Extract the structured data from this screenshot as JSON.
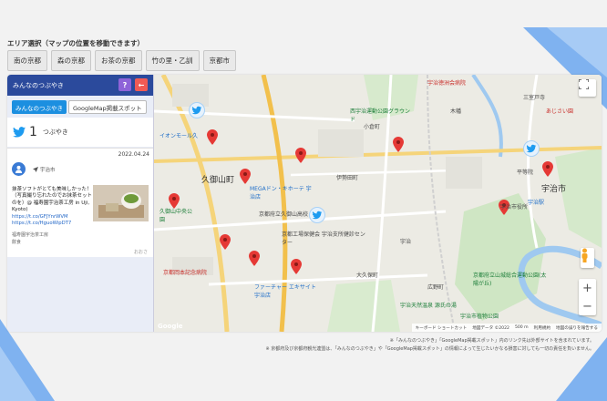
{
  "area": {
    "title": "エリア選択（マップの位置を移動できます）",
    "buttons": [
      "南の京都",
      "森の京都",
      "お茶の京都",
      "竹の里・乙訓",
      "京都市"
    ]
  },
  "panel": {
    "title": "みんなのつぶやき",
    "help_label": "?",
    "back_label": "←",
    "tabs": [
      "みんなのつぶやき",
      "GoogleMap掲載スポット"
    ],
    "count": "1",
    "count_unit": "つぶやき"
  },
  "post": {
    "date": "2022.04.24",
    "location": "宇治市",
    "text": "抹茶ソフトがとても美味しかった！（写真撮り忘れたのでお抹茶セットのを）@ 福寿園宇治茶工房 in Uji, Kyoto)",
    "links": [
      "https://t.co/GFJYnrWVM",
      "https://t.co/HguoWipDT7"
    ],
    "meta": [
      "福寿園宇治茶工房",
      "飲食"
    ],
    "footer": "おおさ"
  },
  "map": {
    "labels": {
      "okubo": "久御山町",
      "ujishi": "宇治市",
      "ion": "イオンモール久",
      "mega": "MEGAドン・キホーテ 宇治店",
      "uji_hospital": "宇治徳洲会病院",
      "higashi": "宇治市役所",
      "jinja": "宇治天然温泉 源氏の湯",
      "ujinabe": "大久保町",
      "fast": "ファーチャー エキサイト 宇治店",
      "kyoto_okamoto": "京都岡本記念病院",
      "uji_botanic": "宇治市植物公園",
      "higashi_shrine": "京都府立山城総合運動公園(太陽が丘)",
      "koyama": "小倉町",
      "kubo": "久御山中央公園",
      "nishiogura": "西宇治運動公園グラウンド",
      "ujistation": "宇治駅",
      "kobata": "木幡",
      "ayaha": "あじさい園",
      "mimuroto": "三室戸寺",
      "heiwado": "平等院",
      "iseda": "伊勢田町",
      "keihan": "京都府立久御山高校",
      "uji_support": "京都工場保健会 宇治支所健診センター",
      "oku": "大久保町",
      "kozakai": "宇治",
      "kokyo": "広野町",
      "uji_saku": "宇治"
    },
    "attribution": [
      "キーボード ショートカット",
      "地図データ ©2022",
      "500 m",
      "利用規約",
      "地図の誤りを報告する"
    ],
    "google": "Google"
  },
  "notes": [
    "※「みんなのつぶやき」「GoogleMap掲載スポット」内のリンク先は外部サイトを含まれています。",
    "※ 京都府及び京都府観光連盟は、「みんなのつぶやき」や「GoogleMap掲載スポット」の情報によって生じたいかなる損害に対しても一切の責任を負いません。"
  ],
  "colors": {
    "header": "#2b4a9c",
    "tab": "#1c8fe0",
    "pin": "#e53935"
  }
}
